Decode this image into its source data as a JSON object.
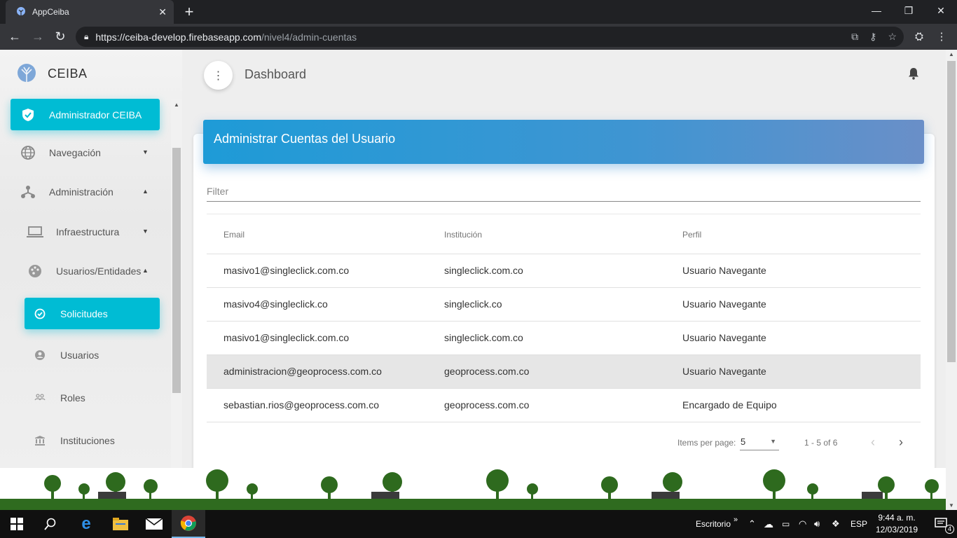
{
  "browser": {
    "tab_title": "AppCeiba",
    "tab_close": "✕",
    "new_tab": "+",
    "url_host": "https://ceiba-develop.firebaseapp.com",
    "url_path": "/nivel4/admin-cuentas"
  },
  "sidebar": {
    "brand": "CEIBA",
    "items": [
      {
        "label": "Administrador CEIBA"
      },
      {
        "label": "Navegación"
      },
      {
        "label": "Administración"
      },
      {
        "label": "Infraestructura"
      },
      {
        "label": "Usuarios/Entidades"
      },
      {
        "label": "Solicitudes"
      },
      {
        "label": "Usuarios"
      },
      {
        "label": "Roles"
      },
      {
        "label": "Instituciones"
      }
    ]
  },
  "header": {
    "title": "Dashboard"
  },
  "card": {
    "title": "Administrar Cuentas del Usuario",
    "filter_placeholder": "Filter",
    "columns": [
      "Email",
      "Institución",
      "Perfil"
    ],
    "rows": [
      {
        "email": "masivo1@singleclick.com.co",
        "institucion": "singleclick.com.co",
        "perfil": "Usuario Navegante"
      },
      {
        "email": "masivo4@singleclick.co",
        "institucion": "singleclick.co",
        "perfil": "Usuario Navegante"
      },
      {
        "email": "masivo1@singleclick.com.co",
        "institucion": "singleclick.com.co",
        "perfil": "Usuario Navegante"
      },
      {
        "email": "administracion@geoprocess.com.co",
        "institucion": "geoprocess.com.co",
        "perfil": "Usuario Navegante"
      },
      {
        "email": "sebastian.rios@geoprocess.com.co",
        "institucion": "geoprocess.com.co",
        "perfil": "Encargado de Equipo"
      }
    ],
    "paginator": {
      "items_per_page_label": "Items per page:",
      "items_per_page": "5",
      "range": "1 - 5 of 6"
    }
  },
  "taskbar": {
    "desktop_label": "Escritorio",
    "language": "ESP",
    "time": "9:44 a. m.",
    "date": "12/03/2019",
    "notifications": "4"
  },
  "colors": {
    "accent": "#00bcd4",
    "header_gradient_start": "#1e9bd7",
    "header_gradient_end": "#6a8fc8"
  }
}
